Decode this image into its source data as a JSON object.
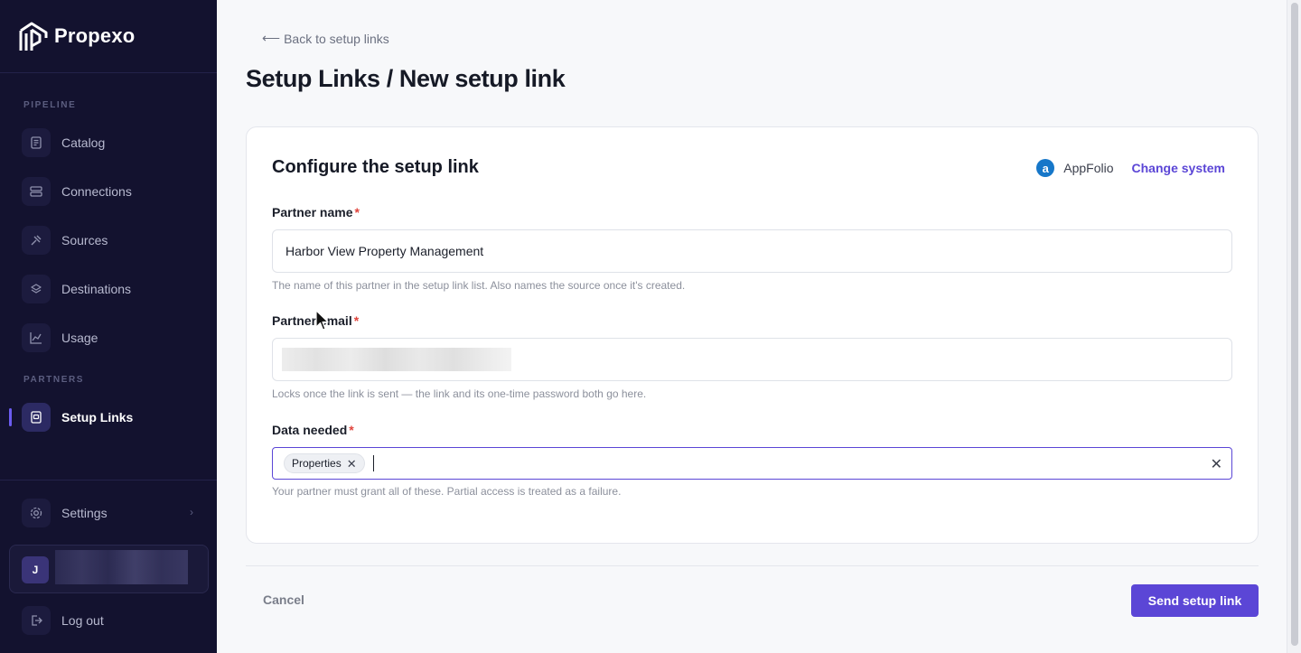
{
  "brand": {
    "name": "Propexo"
  },
  "sidebar": {
    "section_pipeline": "PIPELINE",
    "section_partners": "PARTNERS",
    "items": [
      {
        "label": "Catalog",
        "icon": "catalog-icon"
      },
      {
        "label": "Connections",
        "icon": "connections-icon"
      },
      {
        "label": "Sources",
        "icon": "sources-icon"
      },
      {
        "label": "Destinations",
        "icon": "destinations-icon"
      },
      {
        "label": "Usage",
        "icon": "usage-icon"
      },
      {
        "label": "Setup Links",
        "icon": "setup-links-icon",
        "active": true
      }
    ],
    "settings": "Settings",
    "user_initial": "J",
    "logout": "Log out"
  },
  "main": {
    "back_link": "Back to setup links",
    "page_title": "Setup Links / New setup link",
    "card": {
      "title": "Configure the setup link",
      "system_name": "AppFolio",
      "change_system": "Change system",
      "partner_name_label": "Partner name",
      "partner_name_value": "Harbor View Property Management",
      "partner_name_help": "The name of this partner in the setup link list. Also names the source once it's created.",
      "partner_email_label": "Partner email",
      "partner_email_help": "Locks once the link is sent — the link and its one-time password both go here.",
      "data_needed_label": "Data needed",
      "data_needed_chip": "Properties",
      "data_needed_help": "Your partner must grant all of these. Partial access is treated as a failure.",
      "required_mark": "*"
    },
    "footer": {
      "cancel": "Cancel",
      "send": "Send setup link"
    }
  },
  "colors": {
    "sidebar_bg": "#13122f",
    "accent": "#5b46d6",
    "required": "#e0443c"
  }
}
